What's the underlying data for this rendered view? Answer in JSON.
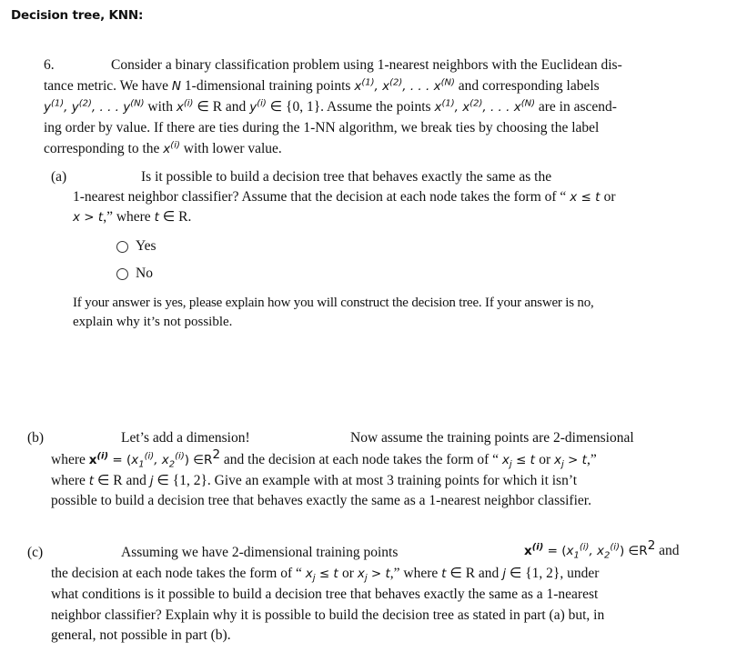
{
  "title": "Decision tree, KNN:",
  "question": {
    "number": "6.",
    "intro": {
      "l1": "Consider a binary classification problem using  1-nearest neighbors with the Euclidean dis-",
      "l2a": "tance metric.   We have ",
      "l2N": "N",
      "l2b": "  1-dimensional training points ",
      "l2pts": "x",
      "l2c": " and corresponding labels",
      "l3a": " with ",
      "l3b": " ∈ R and ",
      "l3c": " ∈ {0, 1}.  Assume the points ",
      "l3d": " are in ascend-",
      "l4": "ing order by value.   If there are ties during the 1-NN algorithm,    we break ties by choosing the label",
      "l5a": "corresponding to the ",
      "l5b": " with lower value."
    },
    "parts": {
      "a": {
        "label": "(a)",
        "l1": "Is it possible to build a decision tree that behaves exactly the same as the",
        "l2a": "1-nearest neighbor classifier? Assume that the decision at each node takes the form of “ ",
        "l2b": " x ≤ t ",
        "l2c": "or",
        "l3a": "x > t",
        "l3b": ",” where ",
        "l3c": "t",
        "l3d": " ∈ R.",
        "options": [
          "Yes",
          "No"
        ],
        "follow1": "If your answer is yes, please explain how you will construct the decision tree. If your answer is no,",
        "follow2": "explain why it’s not possible."
      },
      "b": {
        "label": "(b)",
        "l1a": "Let’s add a dimension!",
        "l1b": "Now assume the training points are 2-dimensional",
        "l2a": "where ",
        "l2b": " = (",
        "l2c": ") ∈R",
        "l2d": " and the decision at each node takes the form of “ ",
        "l2e": "x",
        "l2f": " ≤ t ",
        "l2g": "or ",
        "l2h": " > t",
        "l2i": ",”",
        "l3a": "where ",
        "l3b": "t",
        "l3c": " ∈ R and ",
        "l3d": "j",
        "l3e": " ∈ {1, 2}.  Give an example with at most 3 training points for which it isn’t",
        "l4": "possible to build a decision tree that behaves exactly the same as a 1-nearest neighbor classifier."
      },
      "c": {
        "label": "(c)",
        "l1a": "Assuming we have 2-dimensional training points",
        "l1b": " and",
        "l2a": "the decision at each node takes the form of “ ",
        "l2b": " ≤ t ",
        "l2c": "or ",
        "l2d": " > t",
        "l2e": ",” where ",
        "l2f": " ∈ R and ",
        "l2g": " ∈ {1, 2}, under",
        "l3": "what conditions is it possible to build a decision tree that behaves exactly the same as a 1-nearest",
        "l4": "neighbor classifier? Explain why it is possible to build the decision tree as stated in part (a) but, in",
        "l5": "general, not possible in part (b)."
      }
    }
  }
}
